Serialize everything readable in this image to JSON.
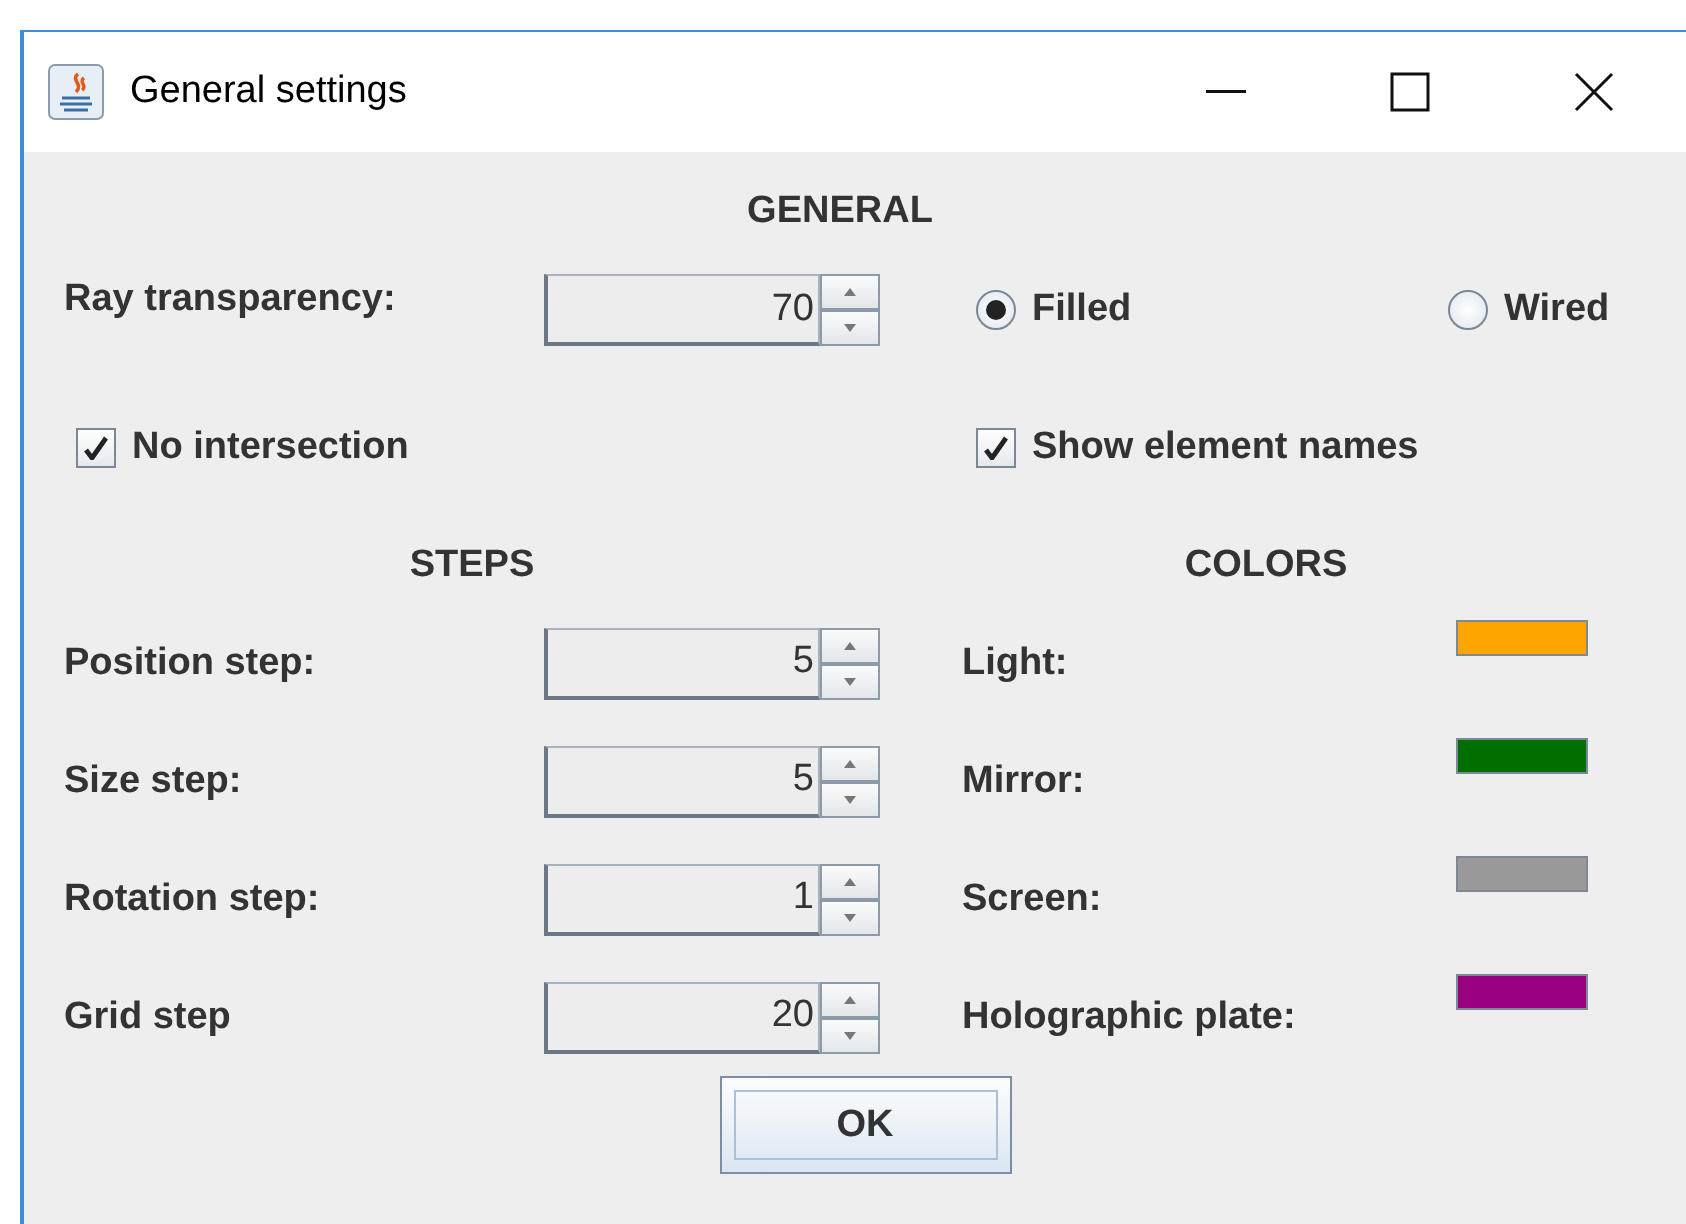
{
  "window": {
    "title": "General settings"
  },
  "general": {
    "heading": "GENERAL",
    "transparency": {
      "label": "Ray transparency:",
      "value": "70"
    },
    "render_modes": [
      {
        "label": "Filled",
        "selected": true
      },
      {
        "label": "Wired",
        "selected": false
      }
    ],
    "options": [
      {
        "label": "No intersection",
        "checked": true
      },
      {
        "label": "Show element names",
        "checked": true
      }
    ]
  },
  "steps": {
    "heading": "STEPS",
    "items": [
      {
        "label": "Position step:",
        "value": "5"
      },
      {
        "label": "Size step:",
        "value": "5"
      },
      {
        "label": "Rotation step:",
        "value": "1"
      },
      {
        "label": "Grid step",
        "value": "20"
      }
    ]
  },
  "colors": {
    "heading": "COLORS",
    "items": [
      {
        "label": "Light:",
        "color": "#ffa500"
      },
      {
        "label": "Mirror:",
        "color": "#006f00"
      },
      {
        "label": "Screen:",
        "color": "#999999"
      },
      {
        "label": "Holographic plate:",
        "color": "#990080"
      }
    ]
  },
  "buttons": [
    "OK"
  ]
}
